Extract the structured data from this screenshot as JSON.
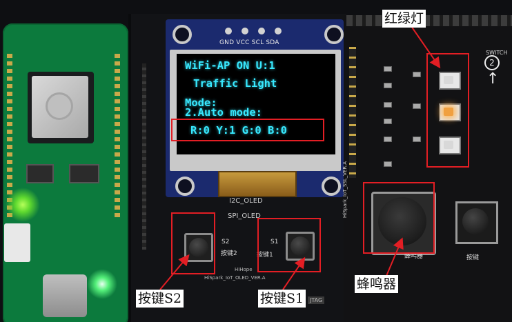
{
  "oled": {
    "pin_labels": "GND VCC SCL SDA",
    "status_line": "WiFi-AP  ON  U:1",
    "title_line": "Traffic Light",
    "mode_label": "Mode:",
    "mode_value": "2.Auto mode:",
    "rgb_line": "R:0 Y:1 G:0 B:0",
    "i2c_label": "I2C_OLED",
    "spi_label": "SPI_OLED",
    "brand": "HiHope",
    "version": "HiSpark_IoT_OLED_VER.A",
    "jtag": "JTAG"
  },
  "board_text": {
    "s2_ref": "S2",
    "s2_name": "按键2",
    "s1_ref": "S1",
    "s1_name": "按键1",
    "buzzer_name": "蜂鸣器",
    "right_button_name": "按键",
    "switch_label": "SWITCH",
    "arrow_number": "2",
    "traffic_version": "HiSpark_IoT_SSL_VER.A"
  },
  "annotations": {
    "traffic_lights": "红绿灯",
    "button_s2": "按键S2",
    "button_s1": "按键S1",
    "buzzer": "蜂鸣器",
    "color": "#e31e24"
  },
  "leds": [
    {
      "name": "red",
      "lit": false
    },
    {
      "name": "yellow",
      "lit": true,
      "color": "#f0a040"
    },
    {
      "name": "green",
      "lit": false
    }
  ],
  "colors": {
    "oled_text": "#38e9ff",
    "mcu_board": "#0c7a3d",
    "oled_pcb": "#1b2a6e"
  }
}
